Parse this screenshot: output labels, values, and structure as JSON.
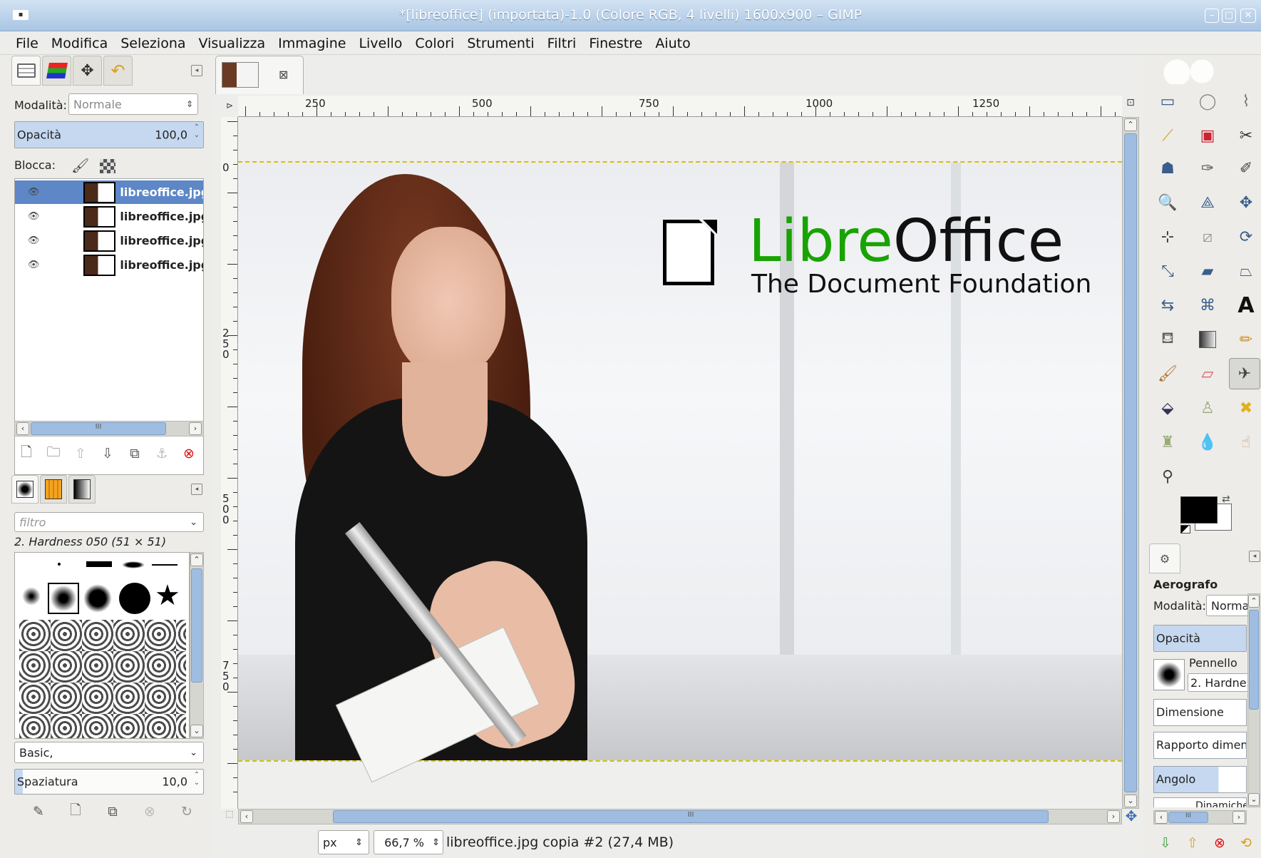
{
  "window": {
    "title": "*[libreoffice] (importata)-1.0 (Colore RGB, 4 livelli) 1600x900 – GIMP"
  },
  "menu": [
    "File",
    "Modifica",
    "Seleziona",
    "Visualizza",
    "Immagine",
    "Livello",
    "Colori",
    "Strumenti",
    "Filtri",
    "Finestre",
    "Aiuto"
  ],
  "layers_dock": {
    "tab_icons": [
      "layers-icon",
      "channels-icon",
      "paths-icon",
      "undo-history-icon"
    ],
    "mode_label": "Modalità:",
    "mode_value": "Normale",
    "opacity_label": "Opacità",
    "opacity_value": "100,0",
    "lock_label": "Blocca:",
    "layers": [
      {
        "name": "libreoffice.jpg",
        "selected": true
      },
      {
        "name": "libreoffice.jpg",
        "selected": false
      },
      {
        "name": "libreoffice.jpg",
        "selected": false
      },
      {
        "name": "libreoffice.jpg",
        "selected": false
      }
    ],
    "scroll_mark": "III"
  },
  "brushes_dock": {
    "filter_placeholder": "filtro",
    "brush_name": "2. Hardness 050 (51 × 51)",
    "preset": "Basic,",
    "spacing_label": "Spaziatura",
    "spacing_value": "10,0"
  },
  "canvas": {
    "tab_close": "⊠",
    "ruler_h": [
      "250",
      "500",
      "750",
      "1000",
      "1250"
    ],
    "ruler_v": [
      "0",
      "250",
      "500",
      "750"
    ],
    "logo_libre": "Libre",
    "logo_office": "Office",
    "logo_foundation": "The Document Foundation",
    "hscroll_mark": "III",
    "unit": "px",
    "zoom": "66,7 %",
    "status": "libreoffice.jpg copia #2 (27,4 MB)"
  },
  "tool_options": {
    "tool_name": "Aerografo",
    "mode_label": "Modalità:",
    "mode_value": "Norma",
    "opacity_label": "Opacità",
    "brush_label": "Pennello",
    "brush_value": "2. Hardne",
    "size_label": "Dimensione",
    "aspect_label": "Rapporto dimen",
    "angle_label": "Angolo",
    "dynamics_label": "Dinamiche",
    "scroll_mark": "III"
  },
  "colors": {
    "foreground": "#000000",
    "background": "#ffffff",
    "selection": "#5d87c6",
    "title_gradient_top": "#d2e2f3",
    "libre_green": "#18a303"
  }
}
